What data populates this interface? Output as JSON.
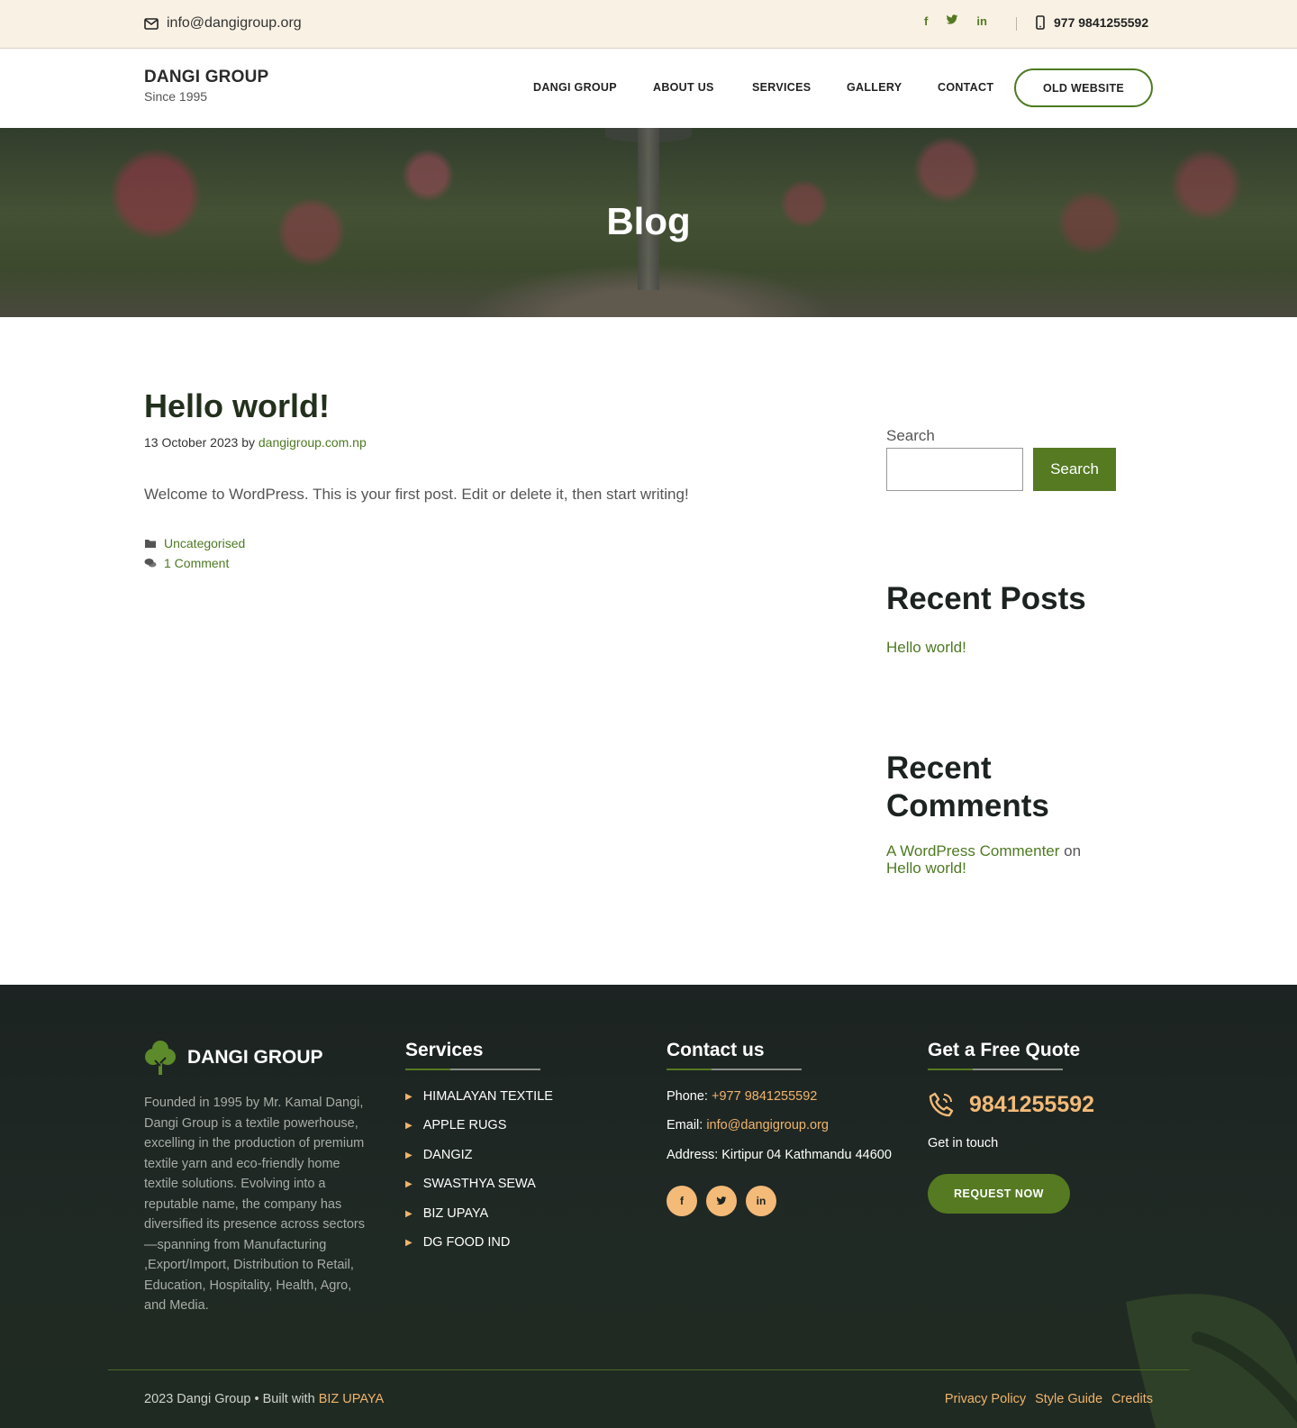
{
  "topbar": {
    "email": "info@dangigroup.org",
    "socials": [
      {
        "icon": "facebook-icon",
        "glyph": "f"
      },
      {
        "icon": "twitter-icon",
        "glyph": "🐦"
      },
      {
        "icon": "linkedin-icon",
        "glyph": "in"
      }
    ],
    "phone": "977 9841255592"
  },
  "header": {
    "brand": "DANGI GROUP",
    "tagline": "Since 1995",
    "nav": [
      "DANGI GROUP",
      "ABOUT US",
      "SERVICES",
      "GALLERY",
      "CONTACT"
    ],
    "cta": "OLD WEBSITE"
  },
  "hero": {
    "title": "Blog"
  },
  "post": {
    "title": "Hello world!",
    "date": "13 October 2023",
    "by": "by",
    "author": "dangigroup.com.np",
    "body": "Welcome to WordPress. This is your first post. Edit or delete it, then start writing!",
    "category": "Uncategorised",
    "comments": "1 Comment"
  },
  "sidebar": {
    "search_label": "Search",
    "search_button": "Search",
    "recent_posts_title": "Recent Posts",
    "recent_posts": [
      "Hello world!"
    ],
    "recent_comments_title_1": "Recent",
    "recent_comments_title_2": "Comments",
    "comment_author": "A WordPress Commenter",
    "comment_on": "on",
    "comment_post": "Hello world!"
  },
  "footer": {
    "brand": "DANGI GROUP",
    "about": "Founded in 1995 by Mr. Kamal Dangi, Dangi Group is a textile powerhouse, excelling in the production of premium textile yarn and eco-friendly home textile solutions. Evolving into a reputable name, the company has diversified its presence across sectors—spanning from Manufacturing ,Export/Import, Distribution to Retail, Education, Hospitality, Health, Agro, and Media.",
    "services_title": "Services",
    "services": [
      "HIMALAYAN TEXTILE",
      "APPLE RUGS",
      "DANGIZ",
      "SWASTHYA SEWA",
      "BIZ UPAYA",
      "DG FOOD IND"
    ],
    "contact_title": "Contact us",
    "phone_label": "Phone:",
    "phone": "+977 9841255592",
    "email_label": "Email:",
    "email": "info@dangigroup.org",
    "address_label": "Address:",
    "address": "Kirtipur 04 Kathmandu 44600",
    "quote_title": "Get a Free Quote",
    "quote_phone": "9841255592",
    "quote_sub": "Get in touch",
    "quote_button": "REQUEST NOW",
    "copyright": "2023 Dangi Group • Built with",
    "builder": "BIZ UPAYA",
    "links": [
      "Privacy Policy",
      "Style Guide",
      "Credits"
    ]
  },
  "colors": {
    "accent": "#557a22",
    "orange": "#f3ba78",
    "topbar_bg": "#f8f1e4",
    "footer_bg": "#1c2322"
  }
}
